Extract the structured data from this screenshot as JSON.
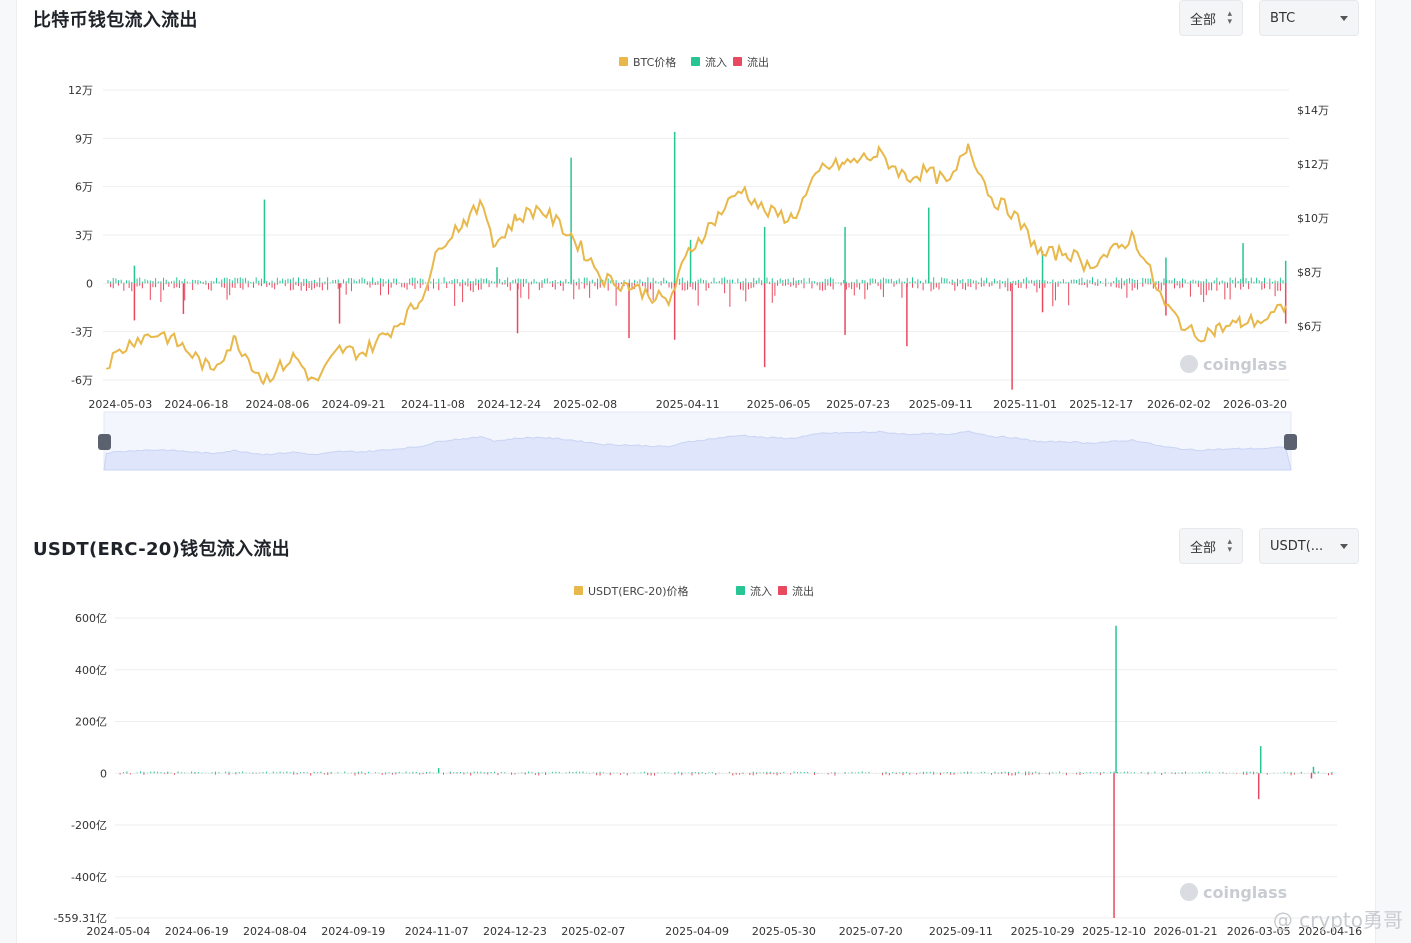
{
  "btc_section": {
    "title": "比特币钱包流入流出",
    "range_select": "全部",
    "coin_select": "BTC"
  },
  "usdt_section": {
    "title": "USDT(ERC-20)钱包流入流出",
    "range_select": "全部",
    "coin_select": "USDT(..."
  },
  "watermark": "coinglass",
  "credit": "@ crypto勇哥",
  "colors": {
    "price": "#e8b84a",
    "inflow": "#27c494",
    "outflow": "#e8495f",
    "grid": "#eeeeee",
    "brush": "#dfe6fb"
  },
  "chart_data": [
    {
      "type": "bar",
      "title": "比特币钱包流入流出",
      "legend": [
        "BTC价格",
        "流入",
        "流出"
      ],
      "legend_position": "top-center",
      "grid": true,
      "x_tick_labels": [
        "2024-05-03",
        "2024-06-18",
        "2024-08-06",
        "2024-09-21",
        "2024-11-08",
        "2024-12-24",
        "2025-02-08",
        "2025-04-11",
        "2025-06-05",
        "2025-07-23",
        "2025-09-11",
        "2025-11-01",
        "2025-12-17",
        "2026-02-02",
        "2026-03-20"
      ],
      "y_left_ticks": [
        "12万",
        "9万",
        "6万",
        "3万",
        "0",
        "-3万",
        "-6万"
      ],
      "y_left_range": [
        -60000,
        120000
      ],
      "y_right_ticks": [
        "$14万",
        "$12万",
        "$10万",
        "$8万",
        "$6万"
      ],
      "y_right_range": [
        54000,
        140000
      ],
      "price_series": {
        "name": "BTC价格",
        "x": [
          "2024-05-03",
          "2024-05-20",
          "2024-06-05",
          "2024-06-18",
          "2024-07-05",
          "2024-07-20",
          "2024-08-06",
          "2024-08-25",
          "2024-09-06",
          "2024-09-21",
          "2024-10-05",
          "2024-10-20",
          "2024-11-08",
          "2024-11-22",
          "2024-12-05",
          "2024-12-17",
          "2024-12-24",
          "2025-01-06",
          "2025-01-20",
          "2025-02-08",
          "2025-02-28",
          "2025-03-15",
          "2025-04-08",
          "2025-04-20",
          "2025-05-10",
          "2025-05-22",
          "2025-06-05",
          "2025-06-22",
          "2025-07-10",
          "2025-07-23",
          "2025-08-13",
          "2025-08-30",
          "2025-09-11",
          "2025-09-25",
          "2025-10-06",
          "2025-10-20",
          "2025-11-01",
          "2025-11-20",
          "2025-12-05",
          "2025-12-17",
          "2026-01-05",
          "2026-01-14",
          "2026-02-02",
          "2026-02-20",
          "2026-03-05",
          "2026-03-20",
          "2026-04-05",
          "2026-04-16"
        ],
        "values": [
          59000,
          66000,
          68000,
          64000,
          57000,
          66000,
          54000,
          61000,
          53000,
          63000,
          62000,
          68000,
          77000,
          95000,
          101000,
          106000,
          94000,
          102000,
          105000,
          97000,
          84000,
          82000,
          77000,
          92000,
          104000,
          111000,
          104000,
          102000,
          117000,
          118000,
          121000,
          114000,
          116000,
          112000,
          124000,
          108000,
          104000,
          91000,
          92000,
          88000,
          93000,
          97000,
          76000,
          67000,
          69000,
          71000,
          72000,
          76000
        ]
      },
      "inflow_spikes": [
        {
          "x": "2024-05-20",
          "value": 11000
        },
        {
          "x": "2024-08-06",
          "value": 52000
        },
        {
          "x": "2024-12-24",
          "value": 10000
        },
        {
          "x": "2025-02-08",
          "value": 78000
        },
        {
          "x": "2025-04-11",
          "value": 94000
        },
        {
          "x": "2025-04-20",
          "value": 27000
        },
        {
          "x": "2025-06-05",
          "value": 35000
        },
        {
          "x": "2025-07-23",
          "value": 35000
        },
        {
          "x": "2025-09-11",
          "value": 47000
        },
        {
          "x": "2025-11-20",
          "value": 20000
        },
        {
          "x": "2026-02-02",
          "value": 16000
        },
        {
          "x": "2026-03-20",
          "value": 25000
        },
        {
          "x": "2026-04-16",
          "value": 14000
        }
      ],
      "outflow_spikes": [
        {
          "x": "2024-05-20",
          "value": -23000
        },
        {
          "x": "2024-06-18",
          "value": -19000
        },
        {
          "x": "2024-09-21",
          "value": -25000
        },
        {
          "x": "2025-01-06",
          "value": -31000
        },
        {
          "x": "2025-03-15",
          "value": -34000
        },
        {
          "x": "2025-04-11",
          "value": -35000
        },
        {
          "x": "2025-06-05",
          "value": -52000
        },
        {
          "x": "2025-07-23",
          "value": -32000
        },
        {
          "x": "2025-08-30",
          "value": -39000
        },
        {
          "x": "2025-11-01",
          "value": -66000
        },
        {
          "x": "2025-11-20",
          "value": -18000
        },
        {
          "x": "2026-02-02",
          "value": -20000
        },
        {
          "x": "2026-04-16",
          "value": -25000
        }
      ]
    },
    {
      "type": "bar",
      "title": "USDT(ERC-20)钱包流入流出",
      "legend": [
        "USDT(ERC-20)价格",
        "流入",
        "流出"
      ],
      "legend_position": "top-center",
      "grid": true,
      "x_tick_labels": [
        "2024-05-04",
        "2024-06-19",
        "2024-08-04",
        "2024-09-19",
        "2024-11-07",
        "2024-12-23",
        "2025-02-07",
        "2025-04-09",
        "2025-05-30",
        "2025-07-20",
        "2025-09-11",
        "2025-10-29",
        "2025-12-10",
        "2026-01-21",
        "2026-03-05",
        "2026-04-16"
      ],
      "y_ticks": [
        "600亿",
        "400亿",
        "200亿",
        "0",
        "-200亿",
        "-400亿",
        "-559.31亿"
      ],
      "y_range": [
        -55931000000,
        60000000000
      ],
      "inflow_spikes": [
        {
          "x": "2024-11-07",
          "value": 2000000000
        },
        {
          "x": "2025-12-10",
          "value": 57000000000
        },
        {
          "x": "2026-03-05",
          "value": 10500000000
        },
        {
          "x": "2026-04-05",
          "value": 2500000000
        }
      ],
      "outflow_spikes": [
        {
          "x": "2025-12-10",
          "value": -55931000000
        },
        {
          "x": "2026-03-05",
          "value": -10000000000
        },
        {
          "x": "2026-04-05",
          "value": -2000000000
        }
      ]
    }
  ]
}
